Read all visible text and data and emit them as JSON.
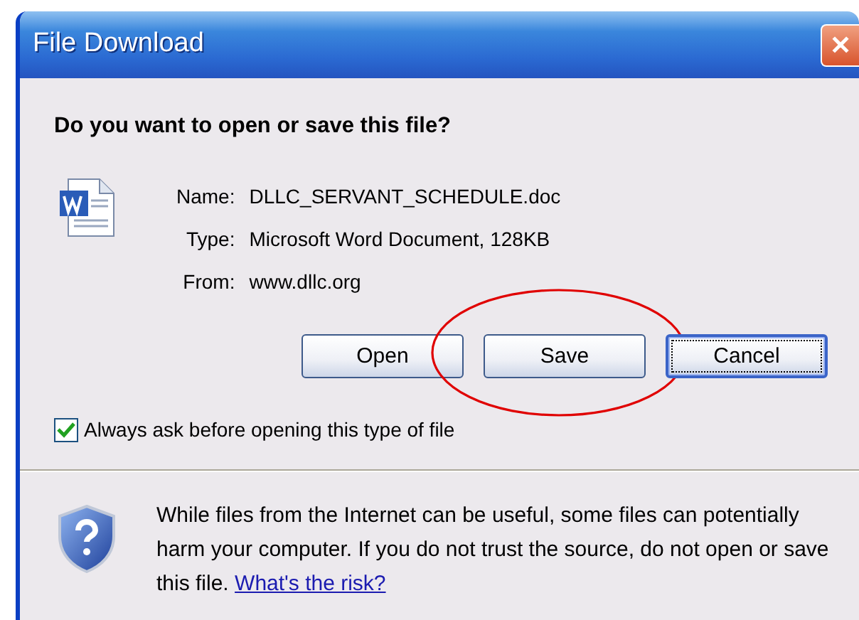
{
  "window": {
    "title": "File Download",
    "close_label": "✕"
  },
  "question": "Do you want to open or save this file?",
  "file": {
    "fields": [
      {
        "label": "Name:",
        "value": "DLLC_SERVANT_SCHEDULE.doc"
      },
      {
        "label": "Type:",
        "value": "Microsoft Word Document, 128KB"
      },
      {
        "label": "From:",
        "value": "www.dllc.org"
      }
    ]
  },
  "buttons": [
    {
      "label": "Open",
      "default": false,
      "circled": false
    },
    {
      "label": "Save",
      "default": false,
      "circled": true
    },
    {
      "label": "Cancel",
      "default": true,
      "circled": false
    }
  ],
  "always_ask": {
    "label": "Always ask before opening this type of file",
    "checked": true
  },
  "warning": {
    "text": "While files from the Internet can be useful, some files can potentially harm your computer. If you do not trust the source, do not open or save this file.",
    "link": "What's the risk?"
  }
}
